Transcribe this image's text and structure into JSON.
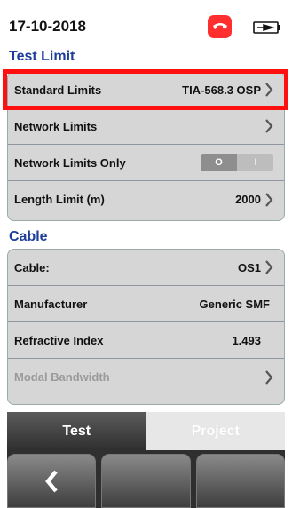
{
  "status": {
    "date": "17-10-2018",
    "phone_icon": "phone-hangup-icon",
    "battery_icon": "battery-icon",
    "accent": "#ff2f2f"
  },
  "test_limit": {
    "title": "Test Limit",
    "rows": [
      {
        "label": "Standard Limits",
        "value": "TIA-568.3 OSP"
      },
      {
        "label": "Network Limits",
        "value": ""
      },
      {
        "label": "Network Limits Only",
        "toggle_off": "O",
        "toggle_on": "I"
      },
      {
        "label": "Length Limit (m)",
        "value": "2000"
      }
    ]
  },
  "cable": {
    "title": "Cable",
    "rows": [
      {
        "label": "Cable:",
        "value": "OS1"
      },
      {
        "label": "Manufacturer",
        "value": "Generic SMF"
      },
      {
        "label": "Refractive Index",
        "value": "1.493"
      },
      {
        "label": "Modal Bandwidth",
        "value": ""
      }
    ]
  },
  "tabs": {
    "test": "Test",
    "project": "Project"
  },
  "buttons": {
    "back_icon": "chevron-left-icon"
  }
}
